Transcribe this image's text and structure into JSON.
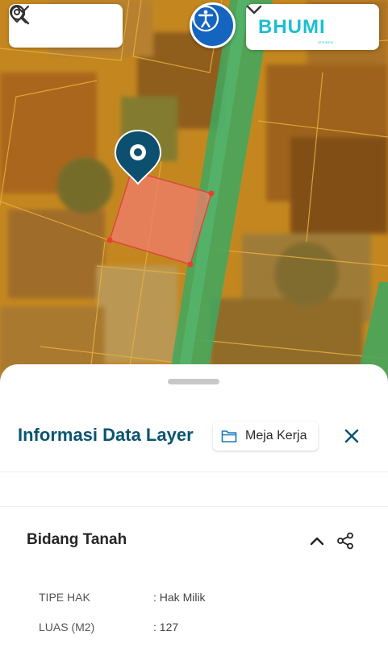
{
  "brand": {
    "name": "BHUMI",
    "tagline": "ATR/BPN"
  },
  "colors": {
    "map_zone": "#c98a22",
    "road": "#3fa860",
    "parcel_fill": "#f07c6c",
    "accent": "#1565c0",
    "title": "#0b5572",
    "brand": "#1bbfd0"
  },
  "icons": {
    "search": "search-icon",
    "zoom": "map-pin-search-icon",
    "accessibility": "accessibility-icon",
    "folder": "folder-icon",
    "close": "close-icon",
    "collapse": "chevron-up-icon",
    "share": "share-icon",
    "marker": "location-marker-icon"
  },
  "sheet": {
    "title": "Informasi Data Layer",
    "workspace_label": "Meja Kerja"
  },
  "section": {
    "title": "Bidang Tanah",
    "rows": [
      {
        "label": "TIPE HAK",
        "value": ": Hak Milik"
      },
      {
        "label": "LUAS (M2)",
        "value": ": 127"
      }
    ]
  }
}
